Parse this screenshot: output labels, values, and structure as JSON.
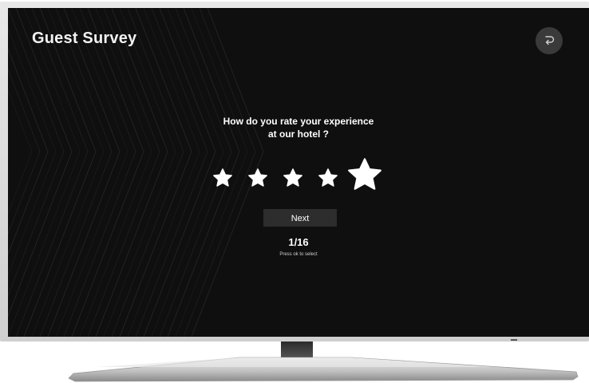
{
  "survey": {
    "title": "Guest Survey",
    "question_line1": "How do you rate your experience",
    "question_line2": "at our hotel ?",
    "rating": {
      "max": 5,
      "focused": 5
    },
    "next_label": "Next",
    "progress": "1/16",
    "hint": "Press ok to select"
  },
  "icons": {
    "back": "back-arrow-icon",
    "star": "star-icon"
  },
  "colors": {
    "screen_bg": "#0f0f0f",
    "text": "#ffffff",
    "button_bg": "#2d2d2d",
    "bezel": "#d8d8d8"
  }
}
